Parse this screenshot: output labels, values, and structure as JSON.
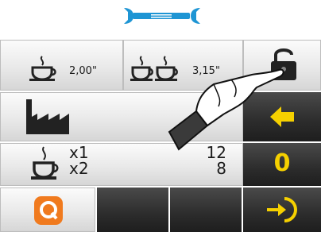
{
  "header": {
    "icon": "wrench-icon",
    "accent_color": "#1e95d4"
  },
  "row1": {
    "single": {
      "icon": "single-coffee-cup-icon",
      "value": "2,00\""
    },
    "double": {
      "icon": "double-coffee-cups-icon",
      "value": "3,15\""
    },
    "lock": {
      "icon": "unlocked-padlock-icon"
    }
  },
  "row2": {
    "left_icon": "factory-icon",
    "right_icon": "back-arrow-icon",
    "arrow_color": "#f5d000"
  },
  "row3": {
    "labels": [
      "x1",
      "x2"
    ],
    "counts": [
      "12",
      "8"
    ],
    "reset_digit": "0"
  },
  "row4": {
    "left_icon": "quick-menu-icon",
    "logo_color": "#f07a1e",
    "right_icon": "login-enter-icon"
  }
}
